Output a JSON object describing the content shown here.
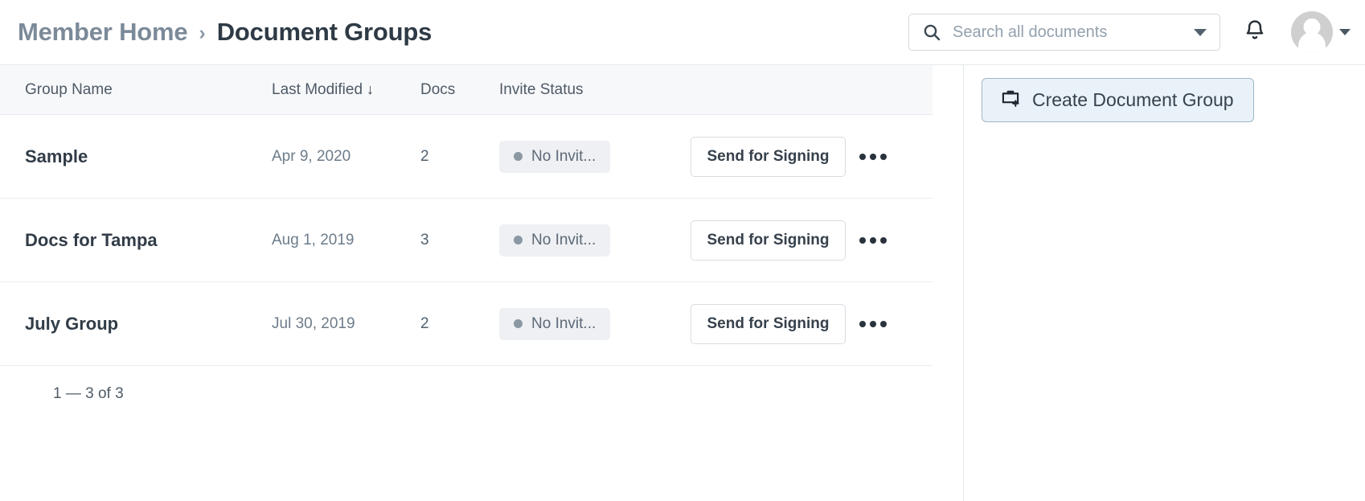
{
  "header": {
    "breadcrumb": {
      "root": "Member Home",
      "separator": "›",
      "current": "Document Groups"
    },
    "search": {
      "placeholder": "Search all documents",
      "value": "",
      "icon": "search-icon",
      "caret_icon": "chevron-down-icon"
    },
    "notifications_icon": "bell-icon",
    "avatar_icon": "avatar",
    "avatar_caret_icon": "chevron-down-icon"
  },
  "table": {
    "columns": [
      {
        "key": "name",
        "label": "Group Name"
      },
      {
        "key": "date",
        "label": "Last Modified"
      },
      {
        "key": "docs",
        "label": "Docs"
      },
      {
        "key": "invite",
        "label": "Invite Status"
      }
    ],
    "sort": {
      "column": "Last Modified",
      "direction_icon": "↓"
    },
    "rows": [
      {
        "name": "Sample",
        "date": "Apr 9, 2020",
        "docs": "2",
        "invite_status": "No Invit...",
        "action_label": "Send for Signing",
        "menu_icon": "ellipsis-icon"
      },
      {
        "name": "Docs for Tampa",
        "date": "Aug 1, 2019",
        "docs": "3",
        "invite_status": "No Invit...",
        "action_label": "Send for Signing",
        "menu_icon": "ellipsis-icon"
      },
      {
        "name": "July Group",
        "date": "Jul 30, 2019",
        "docs": "2",
        "invite_status": "No Invit...",
        "action_label": "Send for Signing",
        "menu_icon": "ellipsis-icon"
      }
    ],
    "pagination": "1 — 3 of 3"
  },
  "sidebar": {
    "create_button": {
      "label": "Create Document Group",
      "icon": "folder-plus-icon"
    }
  },
  "colors": {
    "accent": "#e9f2f8",
    "accent_border": "#9fb8c8",
    "header_row_bg": "#f7f8fa",
    "badge_bg": "#eef0f3",
    "badge_dot": "#8b97a3",
    "text_primary": "#313c47",
    "text_muted": "#6d7c8a"
  }
}
